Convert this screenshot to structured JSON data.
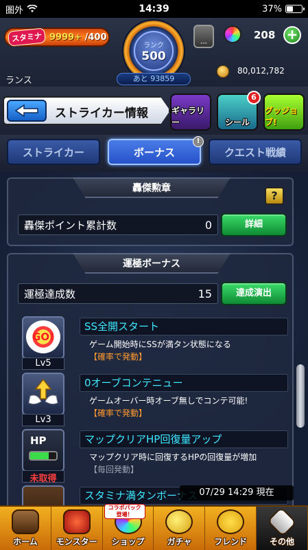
{
  "status_bar": {
    "carrier": "圏外",
    "time": "14:39",
    "battery_pct": "37%",
    "battery_level": 0.37
  },
  "header": {
    "stamina_label": "スタミナ",
    "stamina_current": "9999+",
    "stamina_max": "/400",
    "rank_label": "ランク",
    "rank_value": "500",
    "rank_remaining": "あと 93859",
    "badge_text": "---",
    "orb_count": "208",
    "plus_label": "+",
    "player_name": "ランス",
    "gold": "80,012,782"
  },
  "titlebar": {
    "title": "ストライカー情報",
    "gallery_label": "ギャラリー",
    "seal_label": "シール",
    "seal_notification": "6",
    "gujo_label": "グッジョブ!"
  },
  "tabs": [
    {
      "label": "ストライカー",
      "active": false
    },
    {
      "label": "ボーナス",
      "active": true
    },
    {
      "label": "クエスト戦績",
      "active": false
    }
  ],
  "panel_goketsu": {
    "heading": "轟傑勲章",
    "help_label": "?",
    "stat_label": "轟傑ポイント累計数",
    "stat_value": "0",
    "button_label": "詳細"
  },
  "panel_unkyoku": {
    "heading": "運極ボーナス",
    "stat_label": "運極達成数",
    "stat_value": "15",
    "button_label": "達成演出",
    "items": [
      {
        "title": "SS全開スタート",
        "desc": "ゲーム開始時にSSが満タン状態になる",
        "cond": "【確率で発動】",
        "lv": "Lv5",
        "icon": "go-icon"
      },
      {
        "title": "0オーブコンテニュー",
        "desc": "ゲームオーバー時オーブ無しでコンテ可能!",
        "cond": "【確率で発動】",
        "lv": "Lv3",
        "icon": "wing-arrow-icon"
      },
      {
        "title": "マップクリアHP回復量アップ",
        "desc": "マップクリア時に回復するHPの回復量が増加",
        "cond": "【毎回発動】",
        "lv": "未取得",
        "icon": "hp-icon"
      },
      {
        "title": "スタミナ満タンボーナス",
        "desc": "",
        "cond": "",
        "lv": "",
        "icon": "stamina-icon"
      }
    ]
  },
  "timestamp": "07/29 14:29 現在",
  "bottom_nav": [
    {
      "label": "ホーム",
      "icon": "home-icon"
    },
    {
      "label": "モンスター",
      "icon": "monster-icon"
    },
    {
      "label": "ショップ",
      "icon": "shop-icon",
      "badge": "コラボパック 登場！"
    },
    {
      "label": "ガチャ",
      "icon": "gacha-icon"
    },
    {
      "label": "フレンド",
      "icon": "friend-icon"
    },
    {
      "label": "その他",
      "icon": "other-icon"
    }
  ],
  "colors": {
    "accent_blue": "#2552c8",
    "bonus_title": "#3ee8ff",
    "condition_orange": "#ff9a30",
    "green_button": "#1fae4a",
    "nav_orange": "#f2b020"
  }
}
